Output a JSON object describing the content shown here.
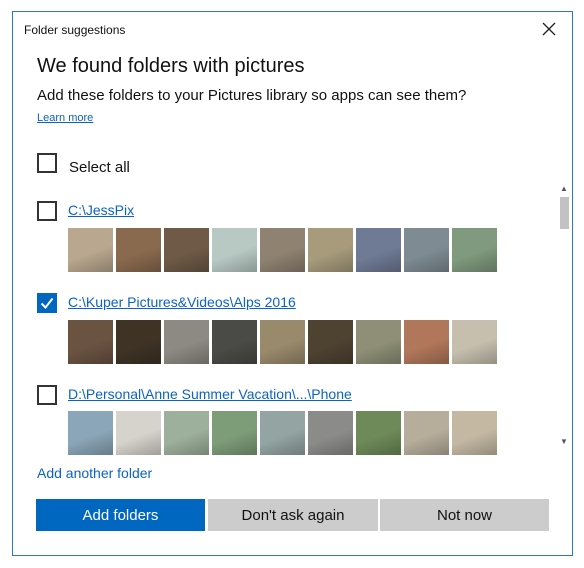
{
  "window": {
    "title": "Folder suggestions"
  },
  "heading": "We found folders with pictures",
  "subheading": "Add these folders to your Pictures library so apps can see them?",
  "learn_more": "Learn more",
  "select_all": {
    "label": "Select all",
    "checked": false
  },
  "folders": [
    {
      "path": "C:\\JessPix",
      "checked": false,
      "thumbnail_colors": [
        "#b9a78f",
        "#8a6a4e",
        "#6e5a46",
        "#b8c9c4",
        "#8f8270",
        "#a79b7c",
        "#6f7a95",
        "#7e8b93",
        "#7f9a7e"
      ]
    },
    {
      "path": "C:\\Kuper Pictures&Videos\\Alps 2016",
      "checked": true,
      "thumbnail_colors": [
        "#6b5342",
        "#3f3326",
        "#8c8a82",
        "#4a4a46",
        "#9a8a6c",
        "#4e4231",
        "#8e8f76",
        "#b1775a",
        "#c6bfae"
      ]
    },
    {
      "path": "D:\\Personal\\Anne Summer Vacation\\...\\Phone",
      "checked": false,
      "thumbnail_colors": [
        "#8aa6b8",
        "#d6d3cc",
        "#9db09b",
        "#7d9c78",
        "#93a4a2",
        "#8b8c89",
        "#6e8a58",
        "#b6ad9b",
        "#c4b8a3"
      ]
    }
  ],
  "add_another": "Add another folder",
  "buttons": {
    "add_folders": "Add folders",
    "dont_ask_again": "Don't ask again",
    "not_now": "Not now"
  },
  "colors": {
    "accent": "#0067c0",
    "link": "#0b63c4",
    "secondary_button": "#cccccc",
    "border": "#2b79c9"
  }
}
